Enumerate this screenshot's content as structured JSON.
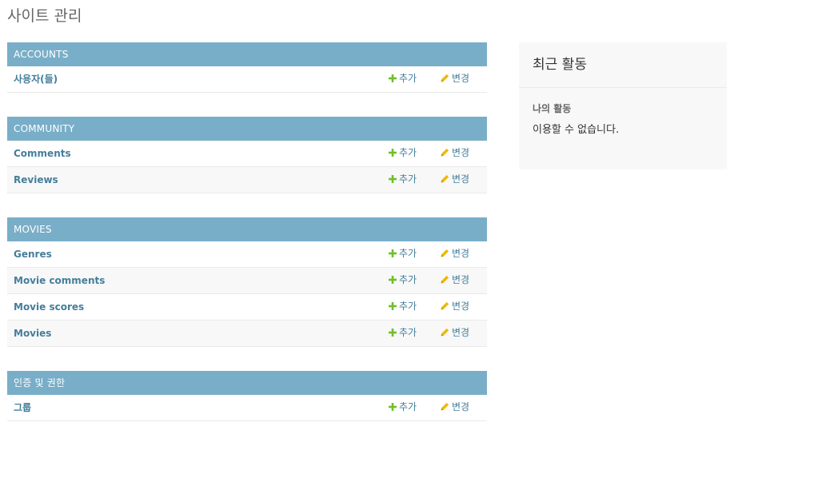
{
  "header": {
    "title": "사이트 관리"
  },
  "labels": {
    "add": "추가",
    "change": "변경"
  },
  "colors": {
    "caption_bg": "#79aec8",
    "link": "#447e9b",
    "add_icon": "#70bf2b",
    "change_icon": "#efb80b"
  },
  "modules": [
    {
      "caption": "ACCOUNTS",
      "models": [
        "사용자(들)"
      ]
    },
    {
      "caption": "COMMUNITY",
      "models": [
        "Comments",
        "Reviews"
      ]
    },
    {
      "caption": "MOVIES",
      "models": [
        "Genres",
        "Movie comments",
        "Movie scores",
        "Movies"
      ]
    },
    {
      "caption": "인증 및 권한",
      "models": [
        "그룹"
      ]
    }
  ],
  "recent_actions": {
    "title": "최근 활동",
    "subtitle": "나의 활동",
    "empty_text": "이용할 수 없습니다."
  }
}
